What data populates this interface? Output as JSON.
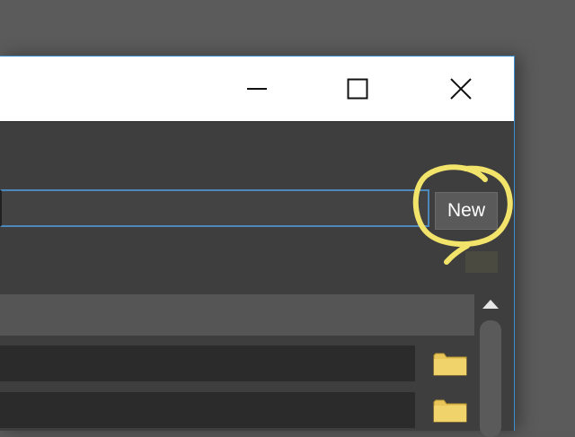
{
  "window": {
    "titlebar": {
      "minimize_icon": "minimize-icon",
      "maximize_icon": "maximize-icon",
      "close_icon": "close-icon"
    },
    "path_field": {
      "value": ""
    },
    "new_button": {
      "label": "New"
    },
    "list": {
      "rows": [
        {
          "icon": "folder-icon"
        },
        {
          "icon": "folder-icon"
        }
      ]
    }
  },
  "colors": {
    "accent": "#3d8fd0",
    "annotation": "#f2e36a",
    "folder": "#e8c65a"
  }
}
